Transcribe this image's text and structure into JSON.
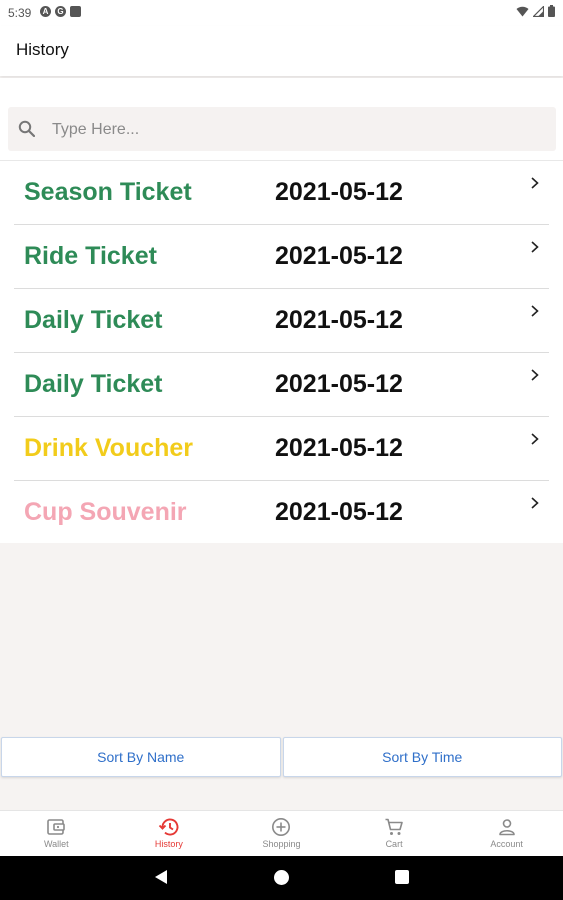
{
  "status_bar": {
    "time": "5:39",
    "left_icons": [
      "A",
      "G",
      "▪"
    ]
  },
  "app_bar": {
    "title": "History"
  },
  "search": {
    "placeholder": "Type Here...",
    "value": ""
  },
  "history": {
    "items": [
      {
        "name": "Season Ticket",
        "date": "2021-05-12",
        "color": "#2e8b57"
      },
      {
        "name": "Ride Ticket",
        "date": "2021-05-12",
        "color": "#2e8b57"
      },
      {
        "name": "Daily Ticket",
        "date": "2021-05-12",
        "color": "#2e8b57"
      },
      {
        "name": "Daily Ticket",
        "date": "2021-05-12",
        "color": "#2e8b57"
      },
      {
        "name": "Drink Voucher",
        "date": "2021-05-12",
        "color": "#f2cc1b"
      },
      {
        "name": "Cup Souvenir",
        "date": "2021-05-12",
        "color": "#f4a6b4"
      }
    ]
  },
  "sort": {
    "by_name": "Sort By Name",
    "by_time": "Sort By Time"
  },
  "bottom_nav": {
    "active": "History",
    "active_color": "#e53935",
    "items": [
      {
        "label": "Wallet",
        "icon": "wallet-icon"
      },
      {
        "label": "History",
        "icon": "history-icon"
      },
      {
        "label": "Shopping",
        "icon": "add-circle-icon"
      },
      {
        "label": "Cart",
        "icon": "cart-icon"
      },
      {
        "label": "Account",
        "icon": "account-icon"
      }
    ]
  }
}
